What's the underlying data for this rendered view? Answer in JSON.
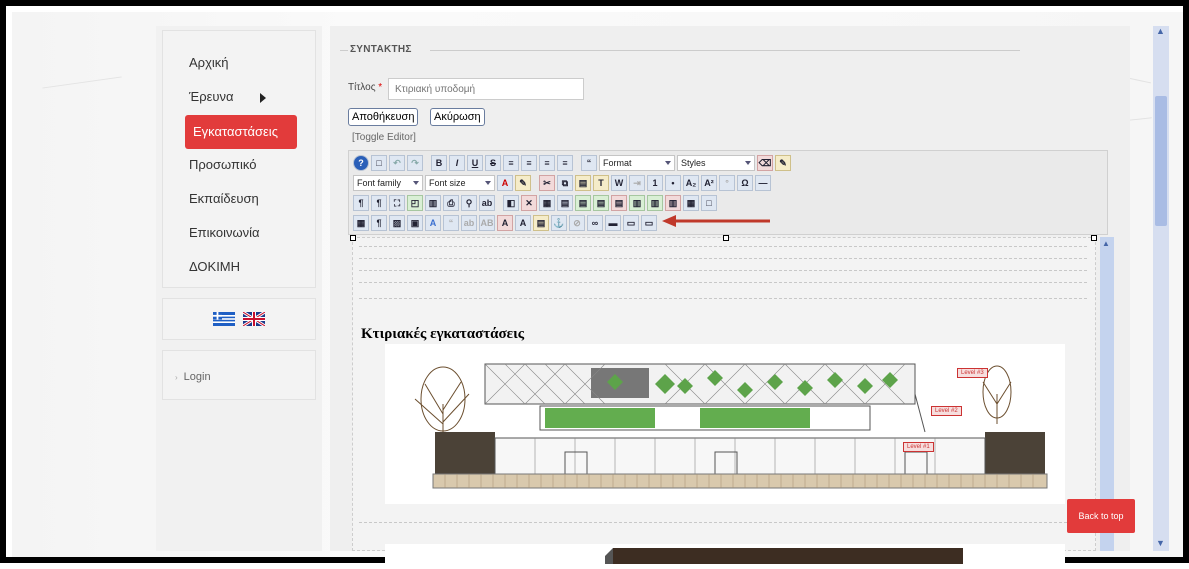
{
  "sidebar": {
    "items": [
      {
        "label": "Αρχική",
        "active": false,
        "submenu": false
      },
      {
        "label": "Έρευνα",
        "active": false,
        "submenu": true
      },
      {
        "label": "Εγκαταστάσεις",
        "active": true,
        "submenu": true
      },
      {
        "label": "Προσωπικό",
        "active": false,
        "submenu": false
      },
      {
        "label": "Εκπαίδευση",
        "active": false,
        "submenu": false
      },
      {
        "label": "Επικοινωνία",
        "active": false,
        "submenu": false
      },
      {
        "label": "ΔΟΚΙΜΗ",
        "active": false,
        "submenu": false
      }
    ],
    "flags": [
      "greek-flag-icon",
      "uk-flag-icon"
    ],
    "login_label": "Login"
  },
  "form": {
    "legend": "ΣΥΝΤΑΚΤΗΣ",
    "title_label": "Τίτλος",
    "required_mark": "*",
    "title_value": "Κτιριακή υποδομή",
    "save_label": "Αποθήκευση",
    "cancel_label": "Ακύρωση",
    "toggle_label": "[Toggle Editor]"
  },
  "toolbar": {
    "format_label": "Format",
    "styles_label": "Styles",
    "font_family_label": "Font family",
    "font_size_label": "Font size"
  },
  "editor": {
    "heading": "Κτιριακές εγκαταστάσεις",
    "image_labels": [
      "Level #3",
      "Level #2",
      "Level #1"
    ]
  },
  "back_to_top_label": "Back to top",
  "colors": {
    "accent": "#e23b3b",
    "scrollbar": "#c4d3ee"
  }
}
